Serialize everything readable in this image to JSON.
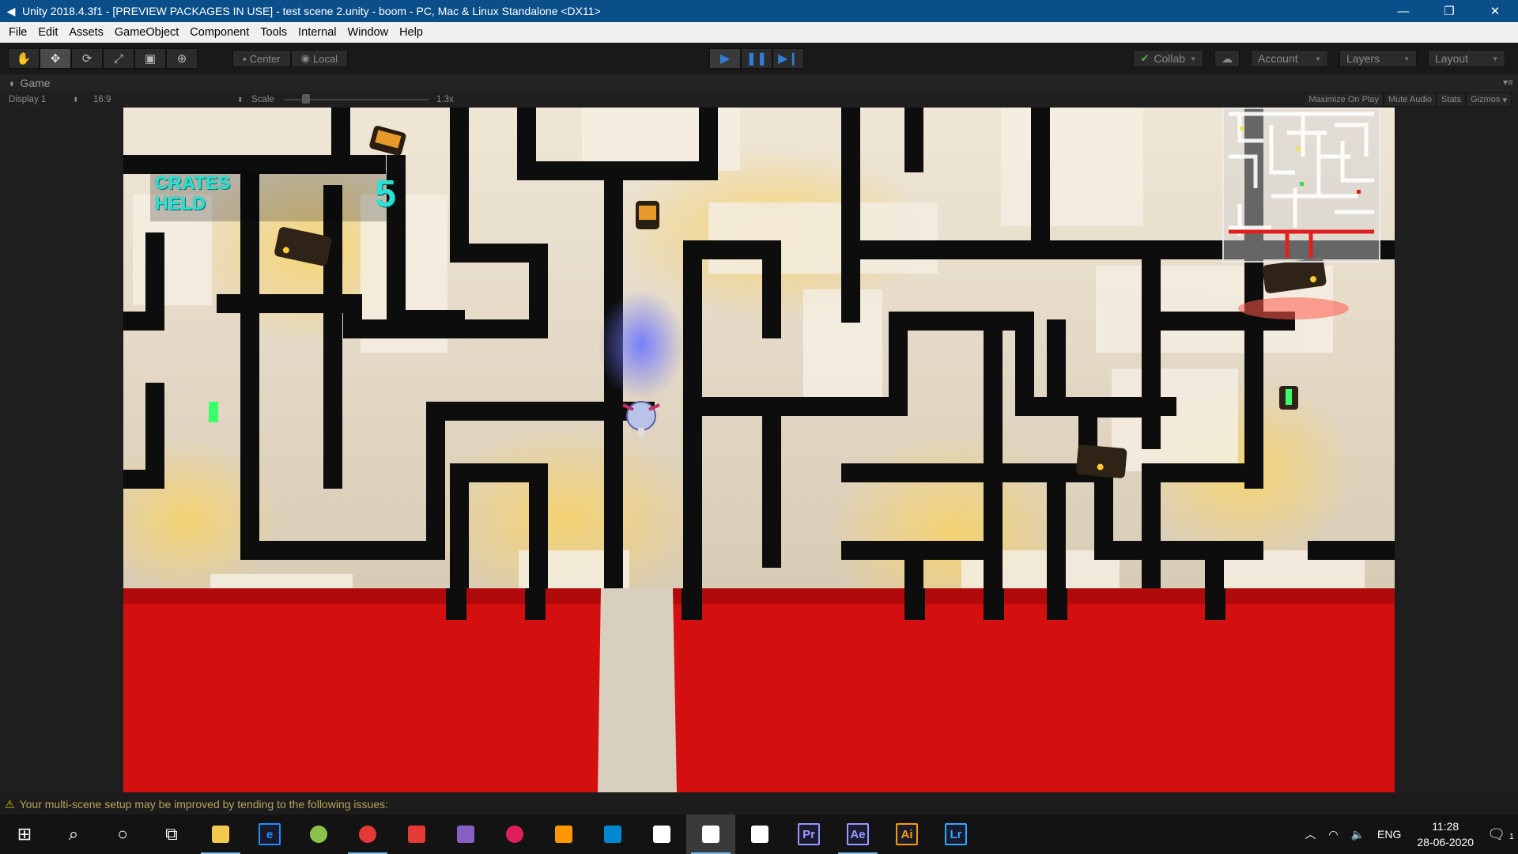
{
  "window": {
    "title": "Unity 2018.4.3f1 - [PREVIEW PACKAGES IN USE] - test scene 2.unity - boom - PC, Mac & Linux Standalone <DX11>",
    "minimize": "—",
    "maximize": "❐",
    "close": "✕"
  },
  "menu": {
    "items": [
      "File",
      "Edit",
      "Assets",
      "GameObject",
      "Component",
      "Tools",
      "Internal",
      "Window",
      "Help"
    ]
  },
  "toolbar": {
    "tools": [
      "hand-icon",
      "move-icon",
      "rotate-icon",
      "scale-icon",
      "rect-icon",
      "transform-icon"
    ],
    "pivot_label": "Center",
    "space_label": "Local",
    "collab_label": "Collab",
    "account_label": "Account",
    "layers_label": "Layers",
    "layout_label": "Layout"
  },
  "game_tab": {
    "label": "Game"
  },
  "game_bar": {
    "display": "Display 1",
    "aspect": "16:9",
    "scale_label": "Scale",
    "scale_value": "1.3x",
    "scale_fraction": 0.12,
    "maximize_on_play": "Maximize On Play",
    "mute_audio": "Mute Audio",
    "stats": "Stats",
    "gizmos": "Gizmos"
  },
  "hud": {
    "label": "CRATES\nHELD",
    "count": "5"
  },
  "status": {
    "message": "Your multi-scene setup may be improved by tending to the following issues:"
  },
  "taskbar": {
    "apps": [
      {
        "name": "file-explorer-icon",
        "label": "",
        "color": "#f2c94c",
        "active": true
      },
      {
        "name": "edge-icon",
        "label": "e",
        "color": "#1e90ff",
        "active": false
      },
      {
        "name": "app-green-icon",
        "label": "",
        "color": "#8bc34a",
        "active": false
      },
      {
        "name": "chrome-icon",
        "label": "",
        "color": "#e53935",
        "active": true
      },
      {
        "name": "store-icon",
        "label": "",
        "color": "#e53935",
        "active": false
      },
      {
        "name": "visual-studio-icon",
        "label": "",
        "color": "#865fc5",
        "active": false
      },
      {
        "name": "slack-icon",
        "label": "",
        "color": "#e01e5a",
        "active": false
      },
      {
        "name": "sublime-icon",
        "label": "",
        "color": "#ff9800",
        "active": false
      },
      {
        "name": "app-blue-icon",
        "label": "",
        "color": "#0288d1",
        "active": false
      },
      {
        "name": "unity-hub-icon",
        "label": "",
        "color": "#ffffff",
        "active": false
      },
      {
        "name": "unity-icon",
        "label": "",
        "color": "#ffffff",
        "active": true
      },
      {
        "name": "unity-icon-2",
        "label": "",
        "color": "#ffffff",
        "active": false
      },
      {
        "name": "premiere-icon",
        "label": "Pr",
        "color": "#9999ff",
        "active": false
      },
      {
        "name": "after-effects-icon",
        "label": "Ae",
        "color": "#9999ff",
        "active": true
      },
      {
        "name": "illustrator-icon",
        "label": "Ai",
        "color": "#ff9a00",
        "active": false
      },
      {
        "name": "lightroom-icon",
        "label": "Lr",
        "color": "#31a8ff",
        "active": false
      }
    ],
    "language": "ENG",
    "time": "11:28",
    "date": "28-06-2020",
    "notification_count": "1"
  }
}
